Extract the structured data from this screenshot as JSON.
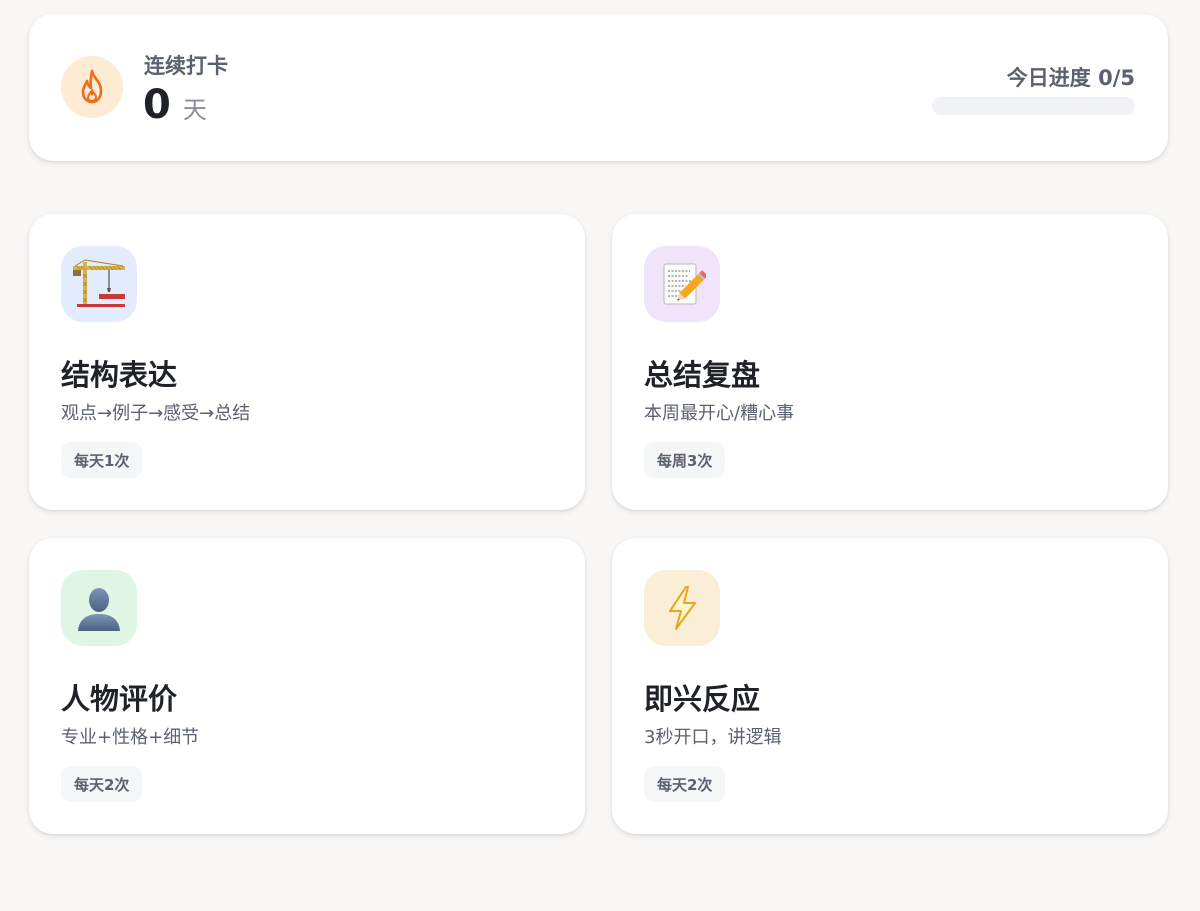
{
  "streak": {
    "label": "连续打卡",
    "count": "0",
    "unit": "天",
    "icon": "flame-icon"
  },
  "progress": {
    "label": "今日进度 0/5",
    "done": 0,
    "total": 5,
    "fill_color": "#f29a3d"
  },
  "tasks": [
    {
      "title": "结构表达",
      "desc": "观点→例子→感受→总结",
      "badge": "每天1次",
      "icon": "crane-icon",
      "icon_bg": "#e2ecfd"
    },
    {
      "title": "总结复盘",
      "desc": "本周最开心/糟心事",
      "badge": "每周3次",
      "icon": "memo-pencil-icon",
      "icon_bg": "#f0e4fb"
    },
    {
      "title": "人物评价",
      "desc": "专业+性格+细节",
      "badge": "每天2次",
      "icon": "person-silhouette-icon",
      "icon_bg": "#dff6e4"
    },
    {
      "title": "即兴反应",
      "desc": "3秒开口，讲逻辑",
      "badge": "每天2次",
      "icon": "lightning-icon",
      "icon_bg": "#fbeed7"
    }
  ]
}
